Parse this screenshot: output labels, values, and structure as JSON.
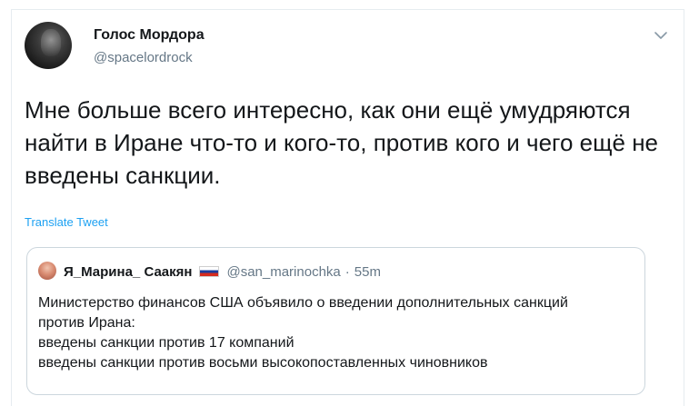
{
  "tweet": {
    "author": {
      "display_name": "Голос Мордора",
      "handle": "@spacelordrock"
    },
    "text": "Мне больше всего интересно, как они ещё умудряются найти в Иране что-то и кого-то, против кого и чего ещё не введены санкции.",
    "translate_label": "Translate Tweet",
    "menu_icon": "chevron-down-icon"
  },
  "quoted_tweet": {
    "author": {
      "display_name": "Я_Марина_ Саакян",
      "flag": "russia-flag",
      "handle": "@san_marinochka",
      "separator": "·",
      "time": "55m"
    },
    "lines": [
      "Министерство финансов США объявило о введении дополнительных санкций",
      "против Ирана:",
      "введены санкции против 17 компаний",
      "введены санкции против восьми высокопоставленных чиновников"
    ]
  },
  "colors": {
    "text": "#14171a",
    "secondary": "#657786",
    "link": "#1da1f2",
    "border": "#ccd6dd"
  }
}
